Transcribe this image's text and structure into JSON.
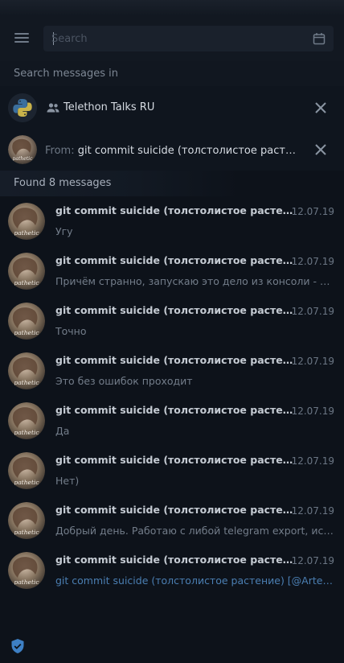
{
  "search": {
    "placeholder": "Search",
    "value": ""
  },
  "search_in": {
    "label": "Search messages in"
  },
  "chat": {
    "name": "Telethon Talks RU"
  },
  "from_filter": {
    "label": "From:",
    "name": "git commit suicide (толстолистое растение) [@ArtemisFowl]"
  },
  "results": {
    "found_label": "Found 8 messages"
  },
  "messages": [
    {
      "sender": "git commit suicide (толстолистое растение) [@ArtemisFowl]",
      "date": "12.07.19",
      "text": "Угу"
    },
    {
      "sender": "git commit suicide (толстолистое растение) [@ArtemisFowl]",
      "date": "12.07.19",
      "text": "Причём странно, запускаю это дело из консоли - все ок"
    },
    {
      "sender": "git commit suicide (толстолистое растение) [@ArtemisFowl]",
      "date": "12.07.19",
      "text": "Точно"
    },
    {
      "sender": "git commit suicide (толстолистое растение) [@ArtemisFowl]",
      "date": "12.07.19",
      "text": "Это без ошибок проходит"
    },
    {
      "sender": "git commit suicide (толстолистое растение) [@ArtemisFowl]",
      "date": "12.07.19",
      "text": "Да"
    },
    {
      "sender": "git commit suicide (толстолистое растение) [@ArtemisFowl]",
      "date": "12.07.19",
      "text": "Нет)"
    },
    {
      "sender": "git commit suicide (толстолистое растение) [@ArtemisFowl]",
      "date": "12.07.19",
      "text": "Добрый день. Работаю с либой telegram export, использую"
    },
    {
      "sender": "git commit suicide (толстолистое растение) [@ArtemisFowl]",
      "date": "12.07.19",
      "text": "git commit suicide (толстолистое растение) [@ArtemisFowl]",
      "is_link": true
    }
  ],
  "avatar": {
    "caption": "pathetic"
  },
  "icons": {
    "menu": "hamburger-icon",
    "calendar": "calendar-icon",
    "group": "group-icon",
    "close": "close-icon",
    "shield": "shield-check-icon",
    "chat_avatar": "python-logo-icon"
  },
  "colors": {
    "background": "#0d121a",
    "link": "#4b7fb3",
    "accent_shield": "#3d7fc4"
  }
}
